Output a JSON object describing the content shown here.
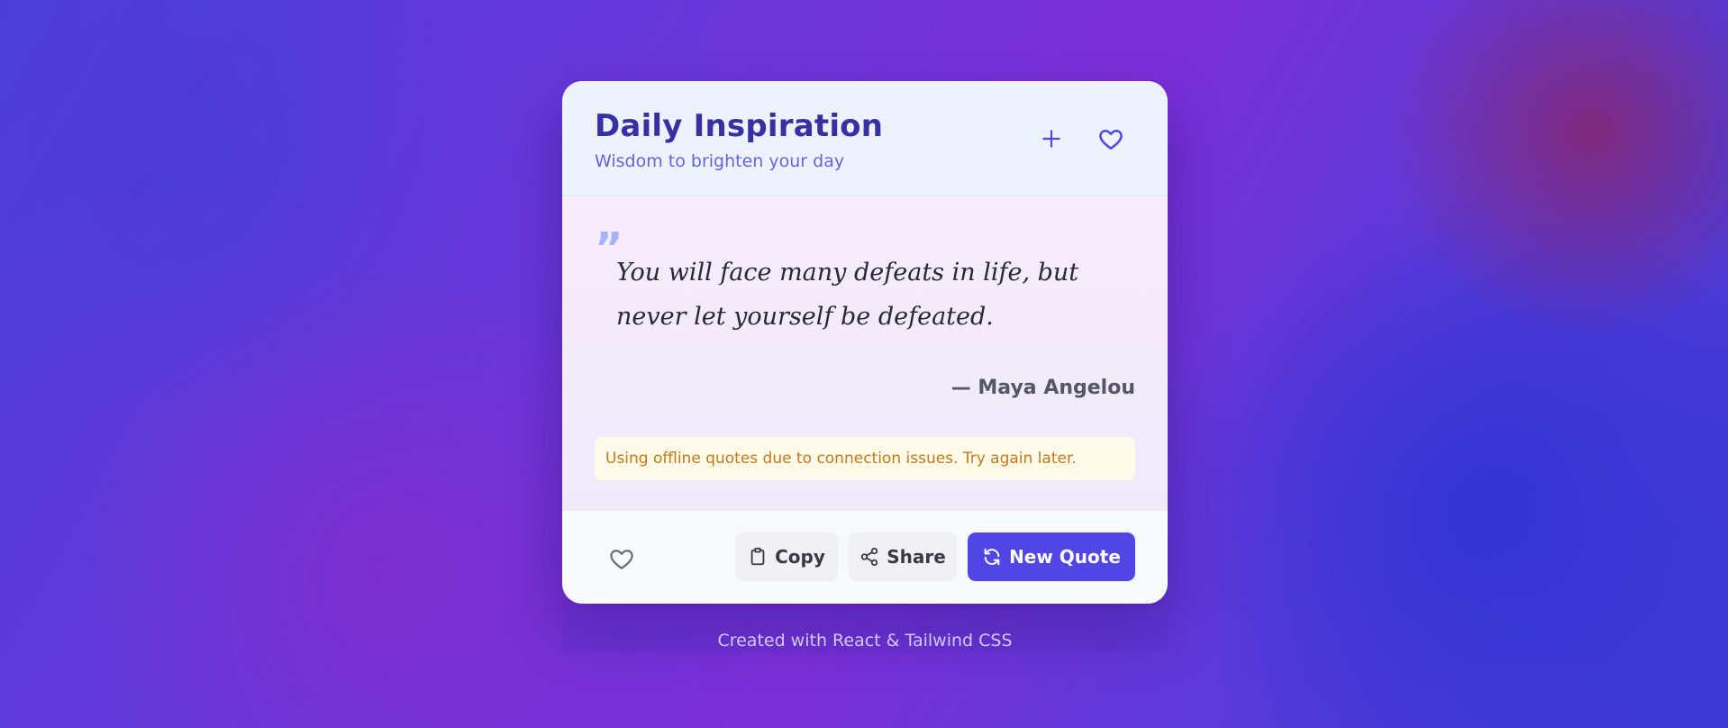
{
  "header": {
    "title": "Daily Inspiration",
    "subtitle": "Wisdom to brighten your day",
    "add_icon": "plus-icon",
    "favorites_icon": "heart-icon"
  },
  "quote": {
    "mark": "”",
    "text": "You will face many defeats in life, but never let yourself be defeated.",
    "author": "— Maya Angelou"
  },
  "notice": {
    "text": "Using offline quotes due to connection issues. Try again later."
  },
  "actions": {
    "like_icon": "heart-outline-icon",
    "copy_label": "Copy",
    "share_label": "Share",
    "new_quote_label": "New Quote"
  },
  "footer": {
    "credit": "Created with React & Tailwind CSS"
  },
  "colors": {
    "accent": "#4f46e5",
    "title": "#3730a3",
    "notice_text": "#c27b15",
    "notice_bg": "#fffbea"
  }
}
